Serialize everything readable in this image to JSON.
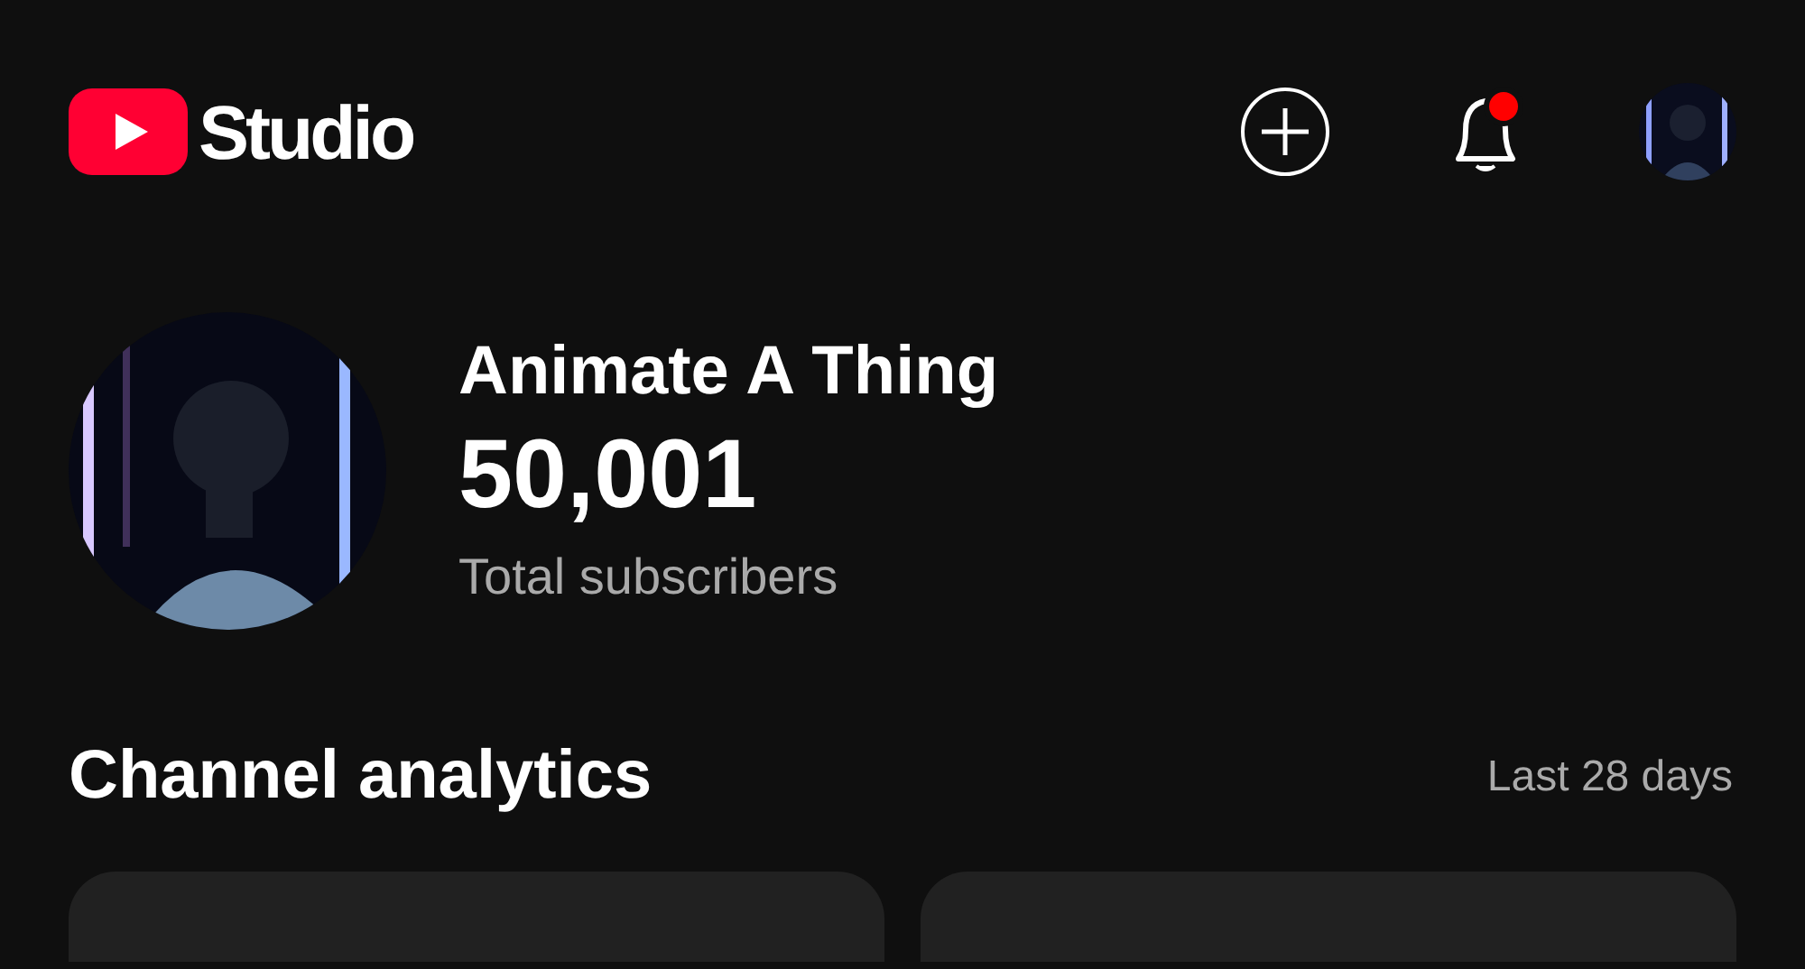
{
  "header": {
    "logo_text": "Studio",
    "notification_badge": true
  },
  "channel": {
    "name": "Animate A Thing",
    "subscribers": "50,001",
    "subscribers_label": "Total subscribers"
  },
  "analytics": {
    "title": "Channel analytics",
    "period": "Last 28 days",
    "cards": [
      {
        "kind": "picture-none"
      },
      {
        "kind": "picture-none"
      }
    ]
  }
}
